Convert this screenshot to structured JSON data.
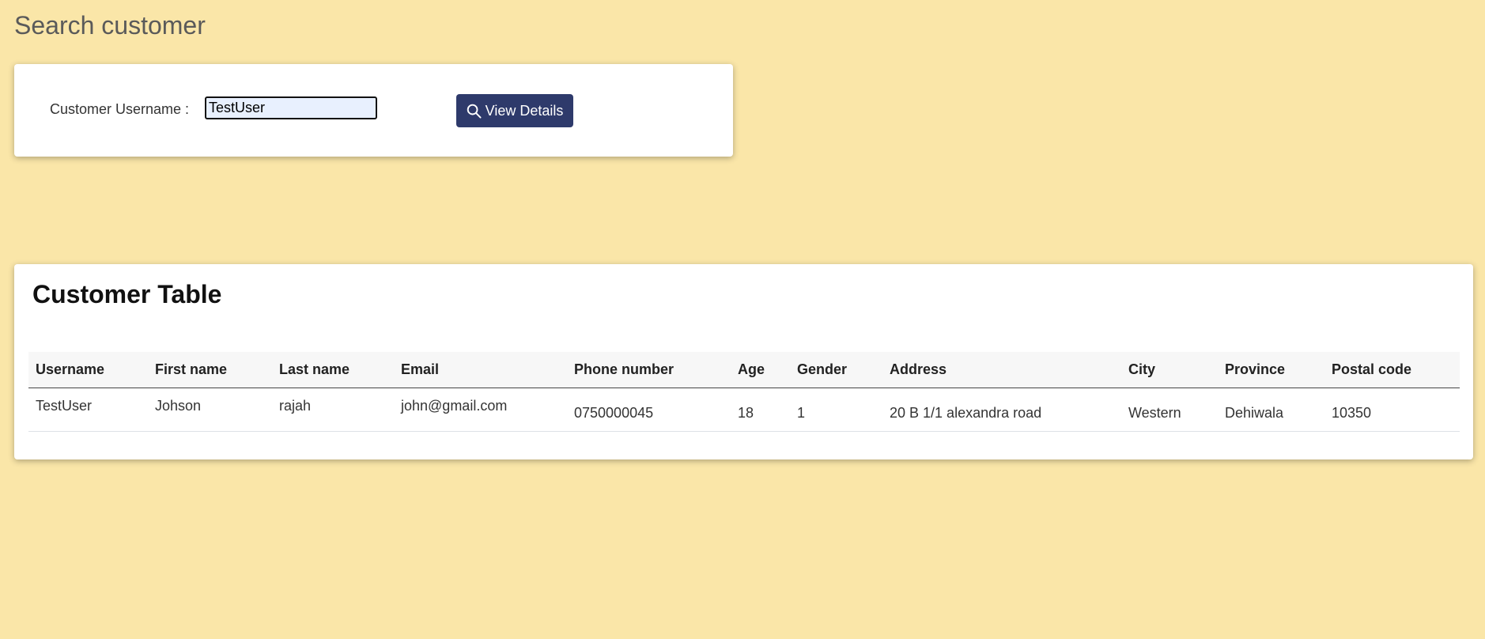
{
  "page": {
    "title": "Search customer",
    "background": "#fae6a8"
  },
  "search": {
    "label": "Customer Username :",
    "value": "TestUser",
    "button_label": "View Details",
    "button_icon": "search-icon",
    "button_color": "#2e3a6b"
  },
  "table": {
    "title": "Customer Table",
    "headers": [
      "Username",
      "First name",
      "Last name",
      "Email",
      "Phone number",
      "Age",
      "Gender",
      "Address",
      "City",
      "Province",
      "Postal code"
    ],
    "rows": [
      [
        "TestUser",
        "Johson",
        "rajah",
        "john@gmail.com",
        "0750000045",
        "18",
        "1",
        "20 B 1/1 alexandra road",
        "Western",
        "Dehiwala",
        "10350"
      ]
    ]
  }
}
